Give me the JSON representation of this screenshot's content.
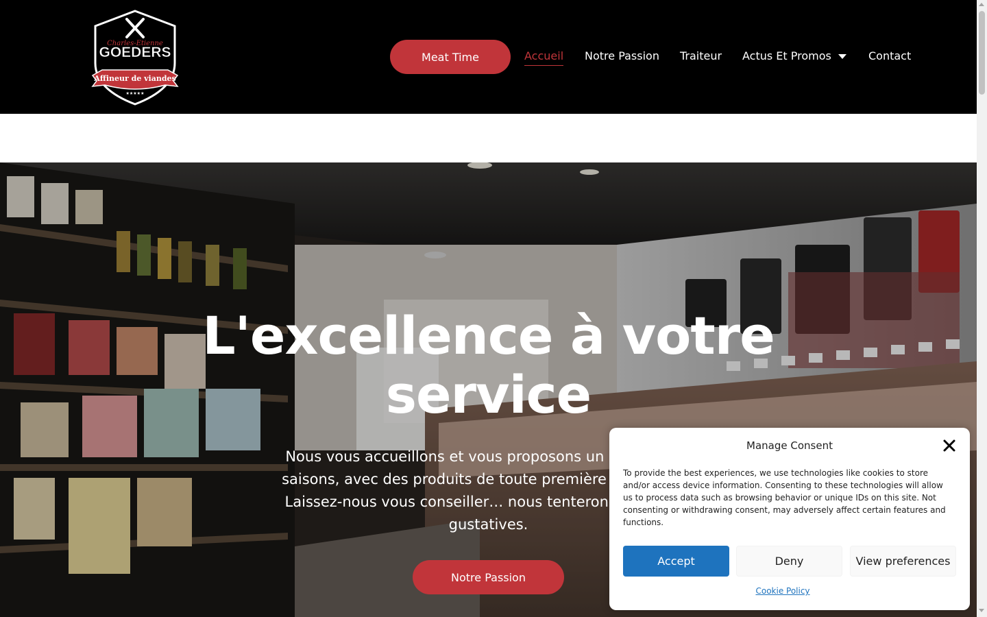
{
  "header": {
    "logo": {
      "icon": "crossed-knives-shield-logo",
      "script_name": "Charles-Etienne",
      "brand": "GOEDERS",
      "ribbon": "Affineur de viandes",
      "stars": "★★★★★"
    },
    "cta_label": "Meat Time",
    "nav": [
      {
        "label": "Accueil",
        "active": true
      },
      {
        "label": "Notre Passion"
      },
      {
        "label": "Traiteur"
      },
      {
        "label": "Actus Et Promos",
        "has_dropdown": true,
        "dropdown_icon": "caret-down-icon"
      },
      {
        "label": "Contact"
      }
    ]
  },
  "hero": {
    "title": "L'excellence à votre service",
    "text": "Nous vous accueillons et vous proposons un comptoir cr… saisons, avec des produits de toute première fraîcheur et … Laissez-nous vous conseiller… nous tenterons de mettre … gustatives.",
    "text_lines": [
      "Nous vous accueillons et vous proposons un comptoir cr",
      "saisons, avec des produits de toute première fraîcheur et",
      "Laissez-nous vous conseiller… nous tenterons de mettre",
      "gustatives."
    ],
    "button_label": "Notre Passion"
  },
  "consent": {
    "title": "Manage Consent",
    "close_icon": "close-icon",
    "text": "To provide the best experiences, we use technologies like cookies to store and/or access device information. Consenting to these technologies will allow us to process data such as browsing behavior or unique IDs on this site. Not consenting or withdrawing consent, may adversely affect certain features and functions.",
    "accept_label": "Accept",
    "deny_label": "Deny",
    "preferences_label": "View preferences",
    "policy_link": "Cookie Policy"
  },
  "colors": {
    "brand_red": "#c1353a",
    "header_bg": "#000000",
    "accept_blue": "#1e73be"
  }
}
